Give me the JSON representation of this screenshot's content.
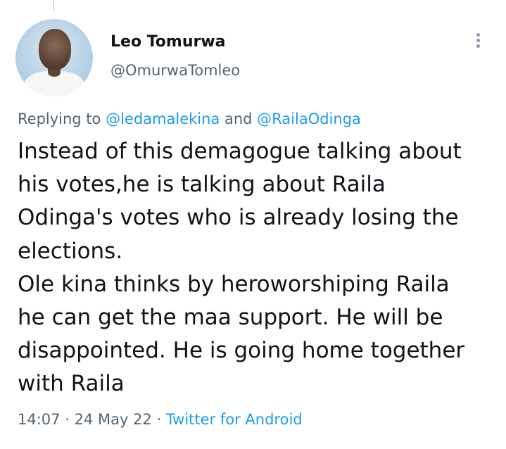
{
  "author": {
    "display_name": "Leo Tomurwa",
    "handle": "@OmurwaTomleo"
  },
  "reply_context": {
    "prefix": "Replying to ",
    "mention_1": "@ledamalekina",
    "conjunction": " and ",
    "mention_2": "@RailaOdinga"
  },
  "tweet": {
    "lines": [
      "Instead of this demagogue talking about",
      "his votes,he is talking about Raila",
      "Odinga's votes who is already losing the",
      "elections.",
      "Ole kina thinks by heroworshiping Raila",
      "he can get the maa support. He will be",
      "disappointed. He is going home together",
      "with Raila"
    ]
  },
  "meta": {
    "time": "14:07",
    "separator_1": " · ",
    "date": "24 May 22",
    "separator_2": " · ",
    "source": "Twitter for Android"
  },
  "icons": {
    "more": "more-vertical-icon"
  },
  "colors": {
    "text": "#0f1419",
    "secondary": "#536471",
    "accent": "#1d9bf0"
  }
}
